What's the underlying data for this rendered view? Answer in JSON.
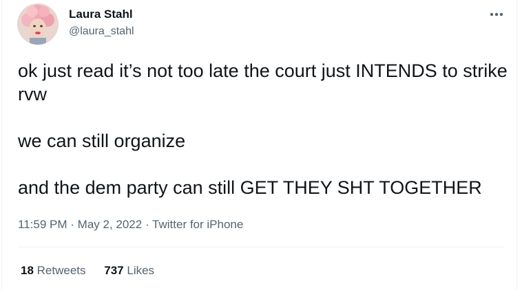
{
  "author": {
    "display_name": "Laura Stahl",
    "handle": "@laura_stahl",
    "avatar_icon": "profile-photo-avatar"
  },
  "tweet": {
    "paragraphs": [
      "ok just read it’s not too late the court just INTENDS to strike rvw",
      "we can still organize",
      "and the dem party can still GET THEY SHT TOGETHER"
    ],
    "time": "11:59 PM",
    "date": "May 2, 2022",
    "separator": "·",
    "source": "Twitter for iPhone"
  },
  "stats": {
    "retweets_count": "18",
    "retweets_label": "Retweets",
    "likes_count": "737",
    "likes_label": "Likes"
  },
  "icons": {
    "more": "more-options-icon"
  },
  "colors": {
    "text_primary": "#0f1419",
    "text_secondary": "#536471",
    "divider": "#eff3f4"
  }
}
